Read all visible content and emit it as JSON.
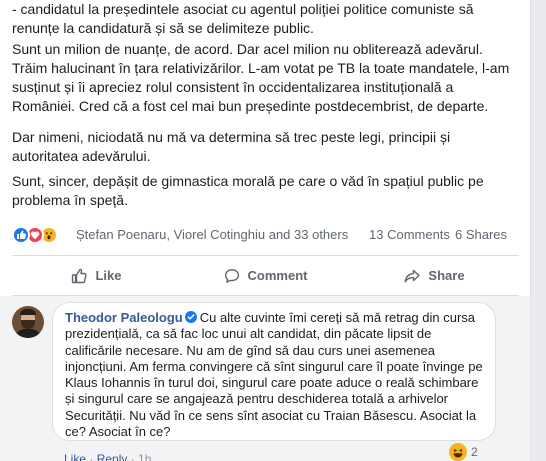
{
  "post": {
    "line_p1": "- candidatul la președintele asociat cu agentul poliției politice comuniste să renunțe la candidatură și să se delimiteze public.",
    "line_p2": "Sunt un milion de nuanțe, de acord. Dar acel milion nu oblitereazǎ adevǎrul. Trǎim halucinant în țara relativizǎrilor. L-am votat pe TB la toate mandatele, l-am susținut și îi apreciez rolul consistent în occidentalizarea instituțională a României. Cred că a fost cel mai bun președinte postdecembrist, de departe.",
    "line_p3": "Dar nimeni, niciodatǎ nu mǎ va determina sǎ trec peste legi, principii și autoritatea adevǎrului.",
    "line_p4": "Sunt, sincer, depǎșit de gimnastica moralǎ pe care o vǎd în spațiul public pe problema în speță."
  },
  "reactions": {
    "icons": [
      "like-icon",
      "love-icon",
      "wow-icon"
    ],
    "names": "Ștefan Poenaru, Viorel Cotinghiu and 33 others",
    "comments": "13 Comments",
    "shares": "6 Shares",
    "colors": {
      "like": "#1877f2",
      "love": "#f33e58",
      "wow": "#f7b125"
    }
  },
  "actions": {
    "like": "Like",
    "comment": "Comment",
    "share": "Share"
  },
  "comment": {
    "author": "Theodor Paleologu",
    "text": "Cu alte cuvinte îmi cereți sǎ mǎ retrag din cursa prezidențialǎ, ca sǎ fac loc unui alt candidat, din pǎcate lipsit de calificǎrile necesare. Nu am de gînd sǎ dau curs unei asemenea injoncțiuni. Am ferma convingere cǎ sînt singurul care îl poate învinge pe Klaus Iohannis în turul doi, singurul care poate aduce o realǎ schimbare și singurul care se angajeazǎ pentru deschiderea totalǎ a arhivelor Securitǎții. Nu vǎd în ce sens sînt asociat cu Traian Bǎsescu. Asociat la ce? Asociat în ce?",
    "reaction_count": "2",
    "reaction_icon": "haha-icon",
    "like_label": "Like",
    "separator": " · ",
    "reply_label": "Reply",
    "time": "1h"
  },
  "colors": {
    "link_blue": "#385898",
    "text": "#1c1e21",
    "muted": "#606770"
  }
}
